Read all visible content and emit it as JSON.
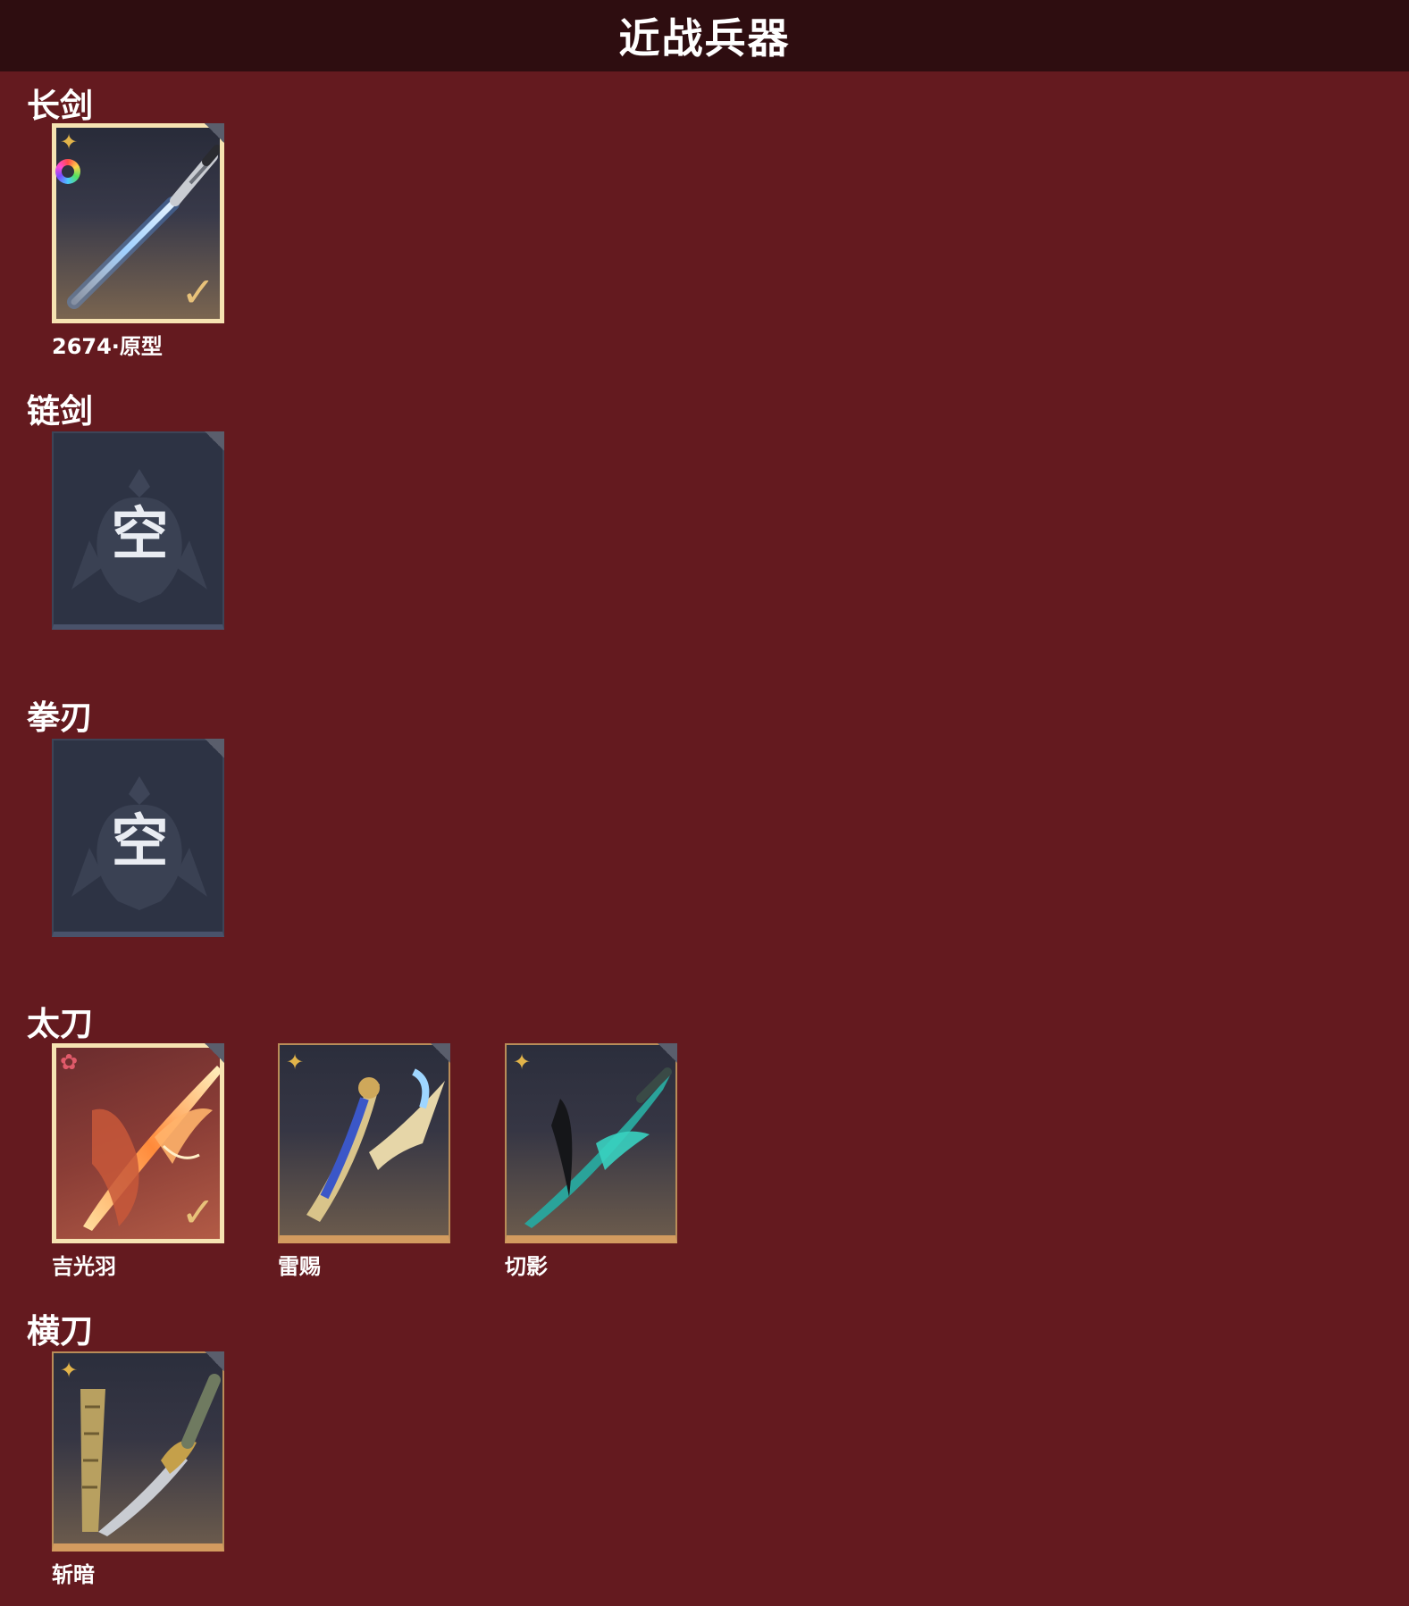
{
  "header": {
    "title": "近战兵器"
  },
  "sections": [
    {
      "title": "长剑",
      "items": [
        {
          "name": "2674·原型",
          "icon": "longsword-icon",
          "selected": true
        }
      ]
    },
    {
      "title": "链剑",
      "items": [
        {
          "empty_label": "空"
        }
      ]
    },
    {
      "title": "拳刃",
      "items": [
        {
          "empty_label": "空"
        }
      ]
    },
    {
      "title": "太刀",
      "items": [
        {
          "name": "吉光羽",
          "icon": "flame-katana-icon",
          "selected": true
        },
        {
          "name": "雷赐",
          "icon": "thunder-katana-icon",
          "selected": false
        },
        {
          "name": "切影",
          "icon": "shadow-katana-icon",
          "selected": false
        }
      ]
    },
    {
      "title": "横刀",
      "items": [
        {
          "name": "斩暗",
          "icon": "broadsword-icon",
          "selected": false
        }
      ]
    }
  ],
  "colors": {
    "background": "#641a1f",
    "header": "#2e0d10",
    "selected_border": "#f6e3b2",
    "gold": "#d39b5f"
  }
}
